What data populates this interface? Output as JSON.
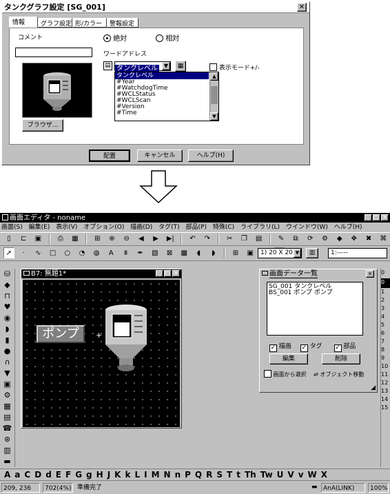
{
  "dialog": {
    "title": "タンクグラフ設定 [SG_001]",
    "tabs": [
      "情報",
      "グラフ設定",
      "形/カラー",
      "警報設定"
    ],
    "comment_label": "コメント",
    "comment_value": "",
    "radio_absolute": "絶対",
    "radio_relative": "相対",
    "word_address_label": "ワードアドレス",
    "address_value": "タンクレベル",
    "display_mode_label": "表示モード+/-",
    "dropdown_options": [
      "タンクレベル",
      "#Year",
      "#WatchdogTime",
      "#WCLStatus",
      "#WCLScan",
      "#Version",
      "#Time"
    ],
    "browse_button": "ブラウザ...",
    "place_button": "配置",
    "cancel_button": "キャンセル",
    "help_button": "ヘルプ(H)"
  },
  "editor": {
    "title": "画面エディタ - noname",
    "menu": [
      "画面(S)",
      "編集(E)",
      "表示(V)",
      "オプション(O)",
      "描画(D)",
      "タグ(T)",
      "部品(P)",
      "特殊(C)",
      "ライブラリ(L)",
      "ウインドウ(W)",
      "ヘルプ(H)"
    ],
    "grid_size": "1) 20 X 20",
    "layer_value": "1:-----",
    "canvas_title": "B7: 無題1*",
    "pump_label": "ポンプ",
    "letters": [
      "A",
      "a",
      "C",
      "D",
      "d",
      "E",
      "F",
      "G",
      "g",
      "H",
      "J",
      "K",
      "k",
      "L",
      "I",
      "M",
      "N",
      "n",
      "P",
      "Q",
      "R",
      "S",
      "T",
      "t",
      "Th",
      "Tw",
      "U",
      "V",
      "v",
      "W",
      "X"
    ],
    "right_numbers": [
      "1",
      "2",
      "3",
      "4",
      "5",
      "6",
      "7",
      "8",
      "9",
      "10",
      "11",
      "12",
      "13",
      "14",
      "15"
    ],
    "status_coords": "209, 236",
    "status_memory": "702(4%)",
    "status_ready": "準備完了",
    "status_link": "AnA(LINK)",
    "status_zoom": "100%"
  },
  "data_list": {
    "title": "画面データ一覧",
    "items": [
      "SG_001 タンクレベル",
      "BS_001 ポンプ ポンプ"
    ],
    "cb_draw": "描画",
    "cb_tag": "タグ",
    "cb_parts": "部品",
    "edit_button": "編集",
    "delete_button": "削除",
    "select_from_screen": "画面から選択",
    "object_move": "オブジェクト移動"
  }
}
